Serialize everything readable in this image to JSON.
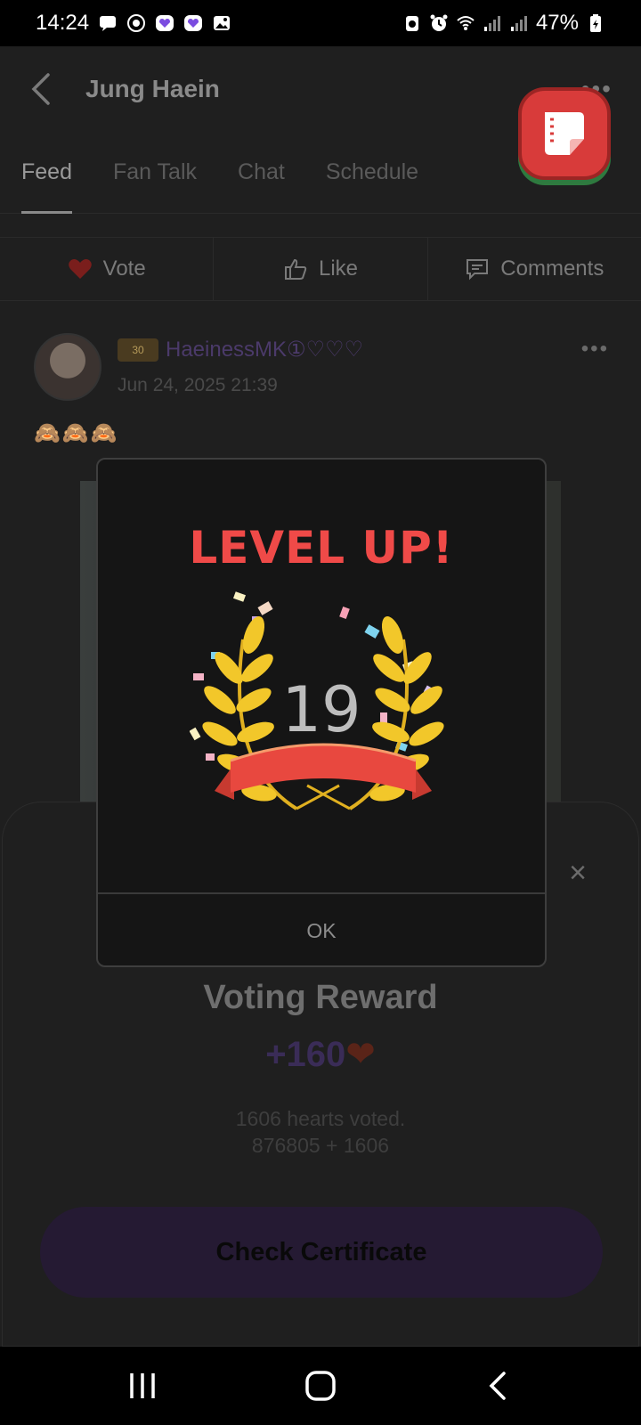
{
  "status_bar": {
    "time": "14:24",
    "battery": "47%",
    "left_icons": [
      "message-icon",
      "whatsapp-icon",
      "app-icon",
      "app-icon",
      "gallery-icon"
    ],
    "right_icons": [
      "battery-saver-icon",
      "alarm-icon",
      "wifi-icon",
      "signal-icon",
      "signal-icon"
    ]
  },
  "header": {
    "title": "Jung Haein",
    "more": "•••"
  },
  "tabs": [
    "Feed",
    "Fan Talk",
    "Chat",
    "Schedule"
  ],
  "actions": {
    "vote": "Vote",
    "like": "Like",
    "comments": "Comments"
  },
  "post": {
    "badge": "30",
    "username": "HaeinessMK①♡♡♡",
    "date": "Jun 24, 2025 21:39",
    "more": "•••",
    "emoji": "🙈🙈🙈"
  },
  "sheet": {
    "close": "×",
    "title": "Voting Reward",
    "amount": "+160",
    "heart": "❤",
    "voted_line1": "1606 hearts voted.",
    "voted_line2": "876805 + 1606",
    "button": "Check Certificate"
  },
  "dialog": {
    "title": "LEVEL UP!",
    "level": "19",
    "ok": "OK"
  },
  "colors": {
    "accent_red": "#ef4a48",
    "wreath_gold": "#f2c72a",
    "ribbon_red": "#e8483f",
    "heart": "#c0392b"
  }
}
